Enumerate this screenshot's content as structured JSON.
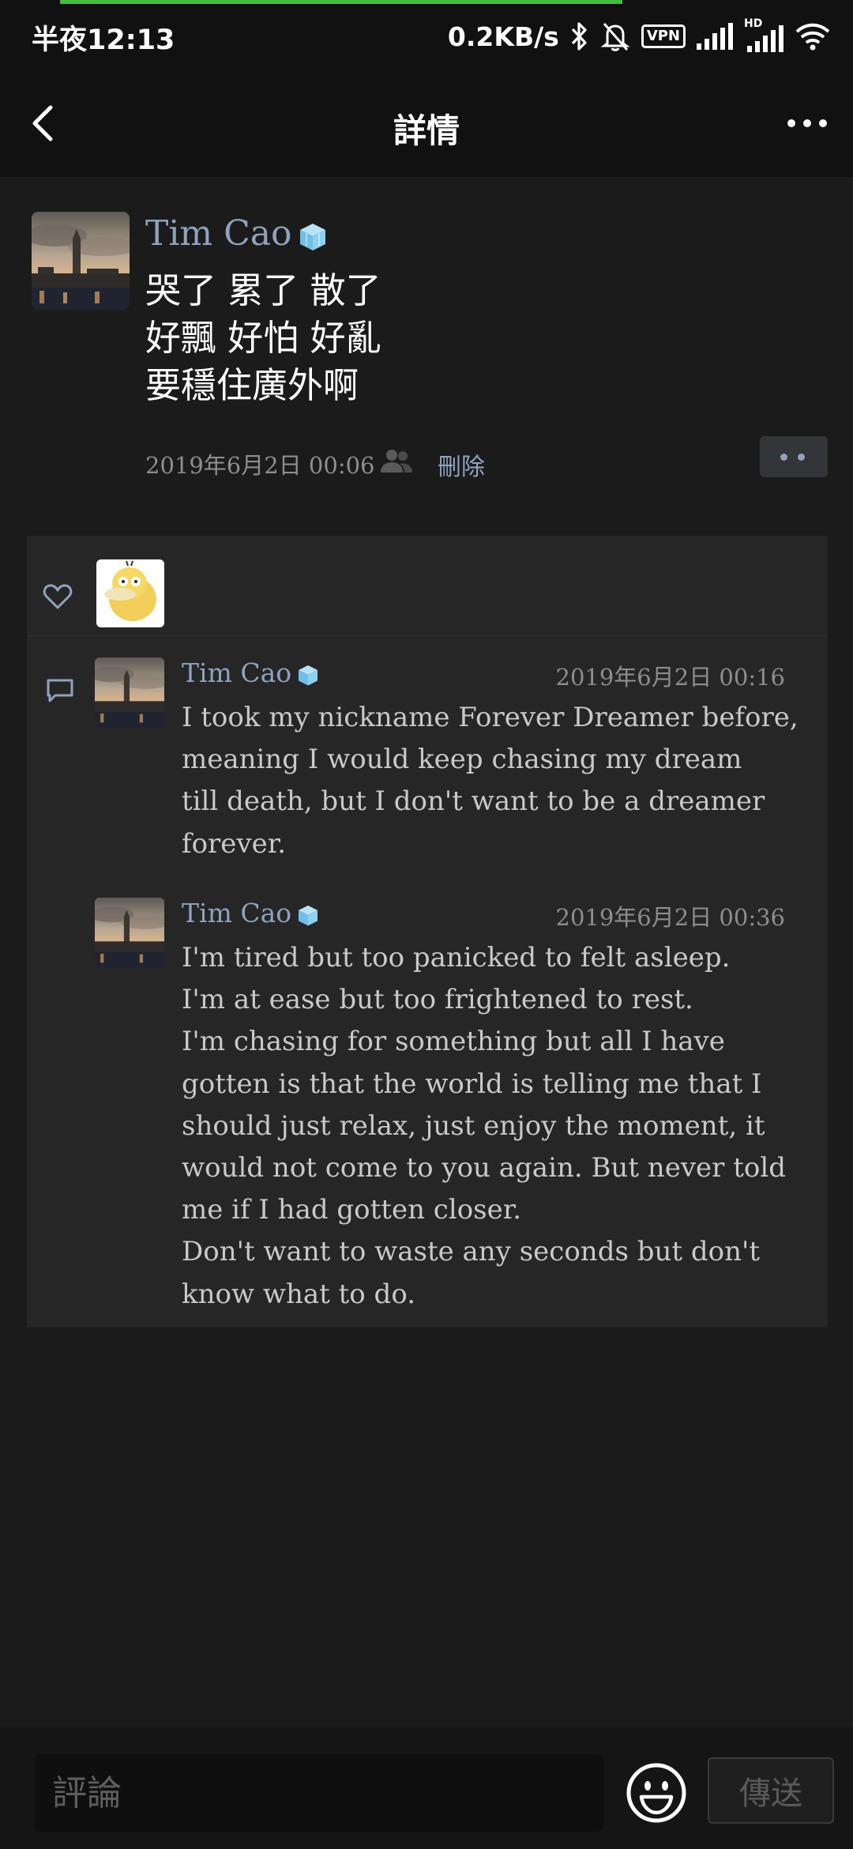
{
  "status_bar": {
    "time": "半夜12:13",
    "net_speed": "0.2KB/s",
    "vpn_label": "VPN",
    "hd_label": "HD",
    "icons": [
      "bluetooth-icon",
      "bell-off-icon",
      "vpn-icon",
      "cellular-signal-icon",
      "cellular-signal-hd-icon",
      "wifi-icon"
    ],
    "progress_color": "#3fbf3a"
  },
  "nav": {
    "title": "詳情",
    "back_icon": "back-chevron-icon",
    "more_icon": "more-icon"
  },
  "post": {
    "author": "Tim Cao",
    "badge_icon": "ice-cube-icon",
    "lines": [
      "哭了 累了 散了",
      "好飄 好怕 好亂",
      "要穩住廣外啊"
    ],
    "date": "2019年6月2日 00:06",
    "delete_label": "刪除",
    "visibility_icon": "friends-visibility-icon"
  },
  "likes": {
    "icon": "heart-icon"
  },
  "comments": [
    {
      "author": "Tim Cao",
      "time": "2019年6月2日 00:16",
      "lines": [
        "I took my nickname Forever Dreamer before,",
        "meaning I would keep chasing my dream",
        "till death, but I don't want to be a dreamer",
        "forever."
      ]
    },
    {
      "author": "Tim Cao",
      "time": "2019年6月2日 00:36",
      "lines": [
        "I'm tired but too panicked to felt asleep.",
        "I'm at ease but too frightened to rest.",
        "I'm chasing for something but all I have",
        "gotten is that the world is telling me that I",
        "should just relax, just enjoy the moment, it",
        "would not come to you again. But never told",
        "me if I had gotten closer.",
        "Don't want to waste any seconds but don't",
        "know what to do."
      ]
    }
  ],
  "input_bar": {
    "placeholder": "評論",
    "send_label": "傳送",
    "emoji_icon": "emoji-icon"
  },
  "colors": {
    "background": "#1b1b1b",
    "header": "#111111",
    "panel": "#262626",
    "name_link": "#8fa3bf",
    "meta_text": "#8e8e8e"
  }
}
